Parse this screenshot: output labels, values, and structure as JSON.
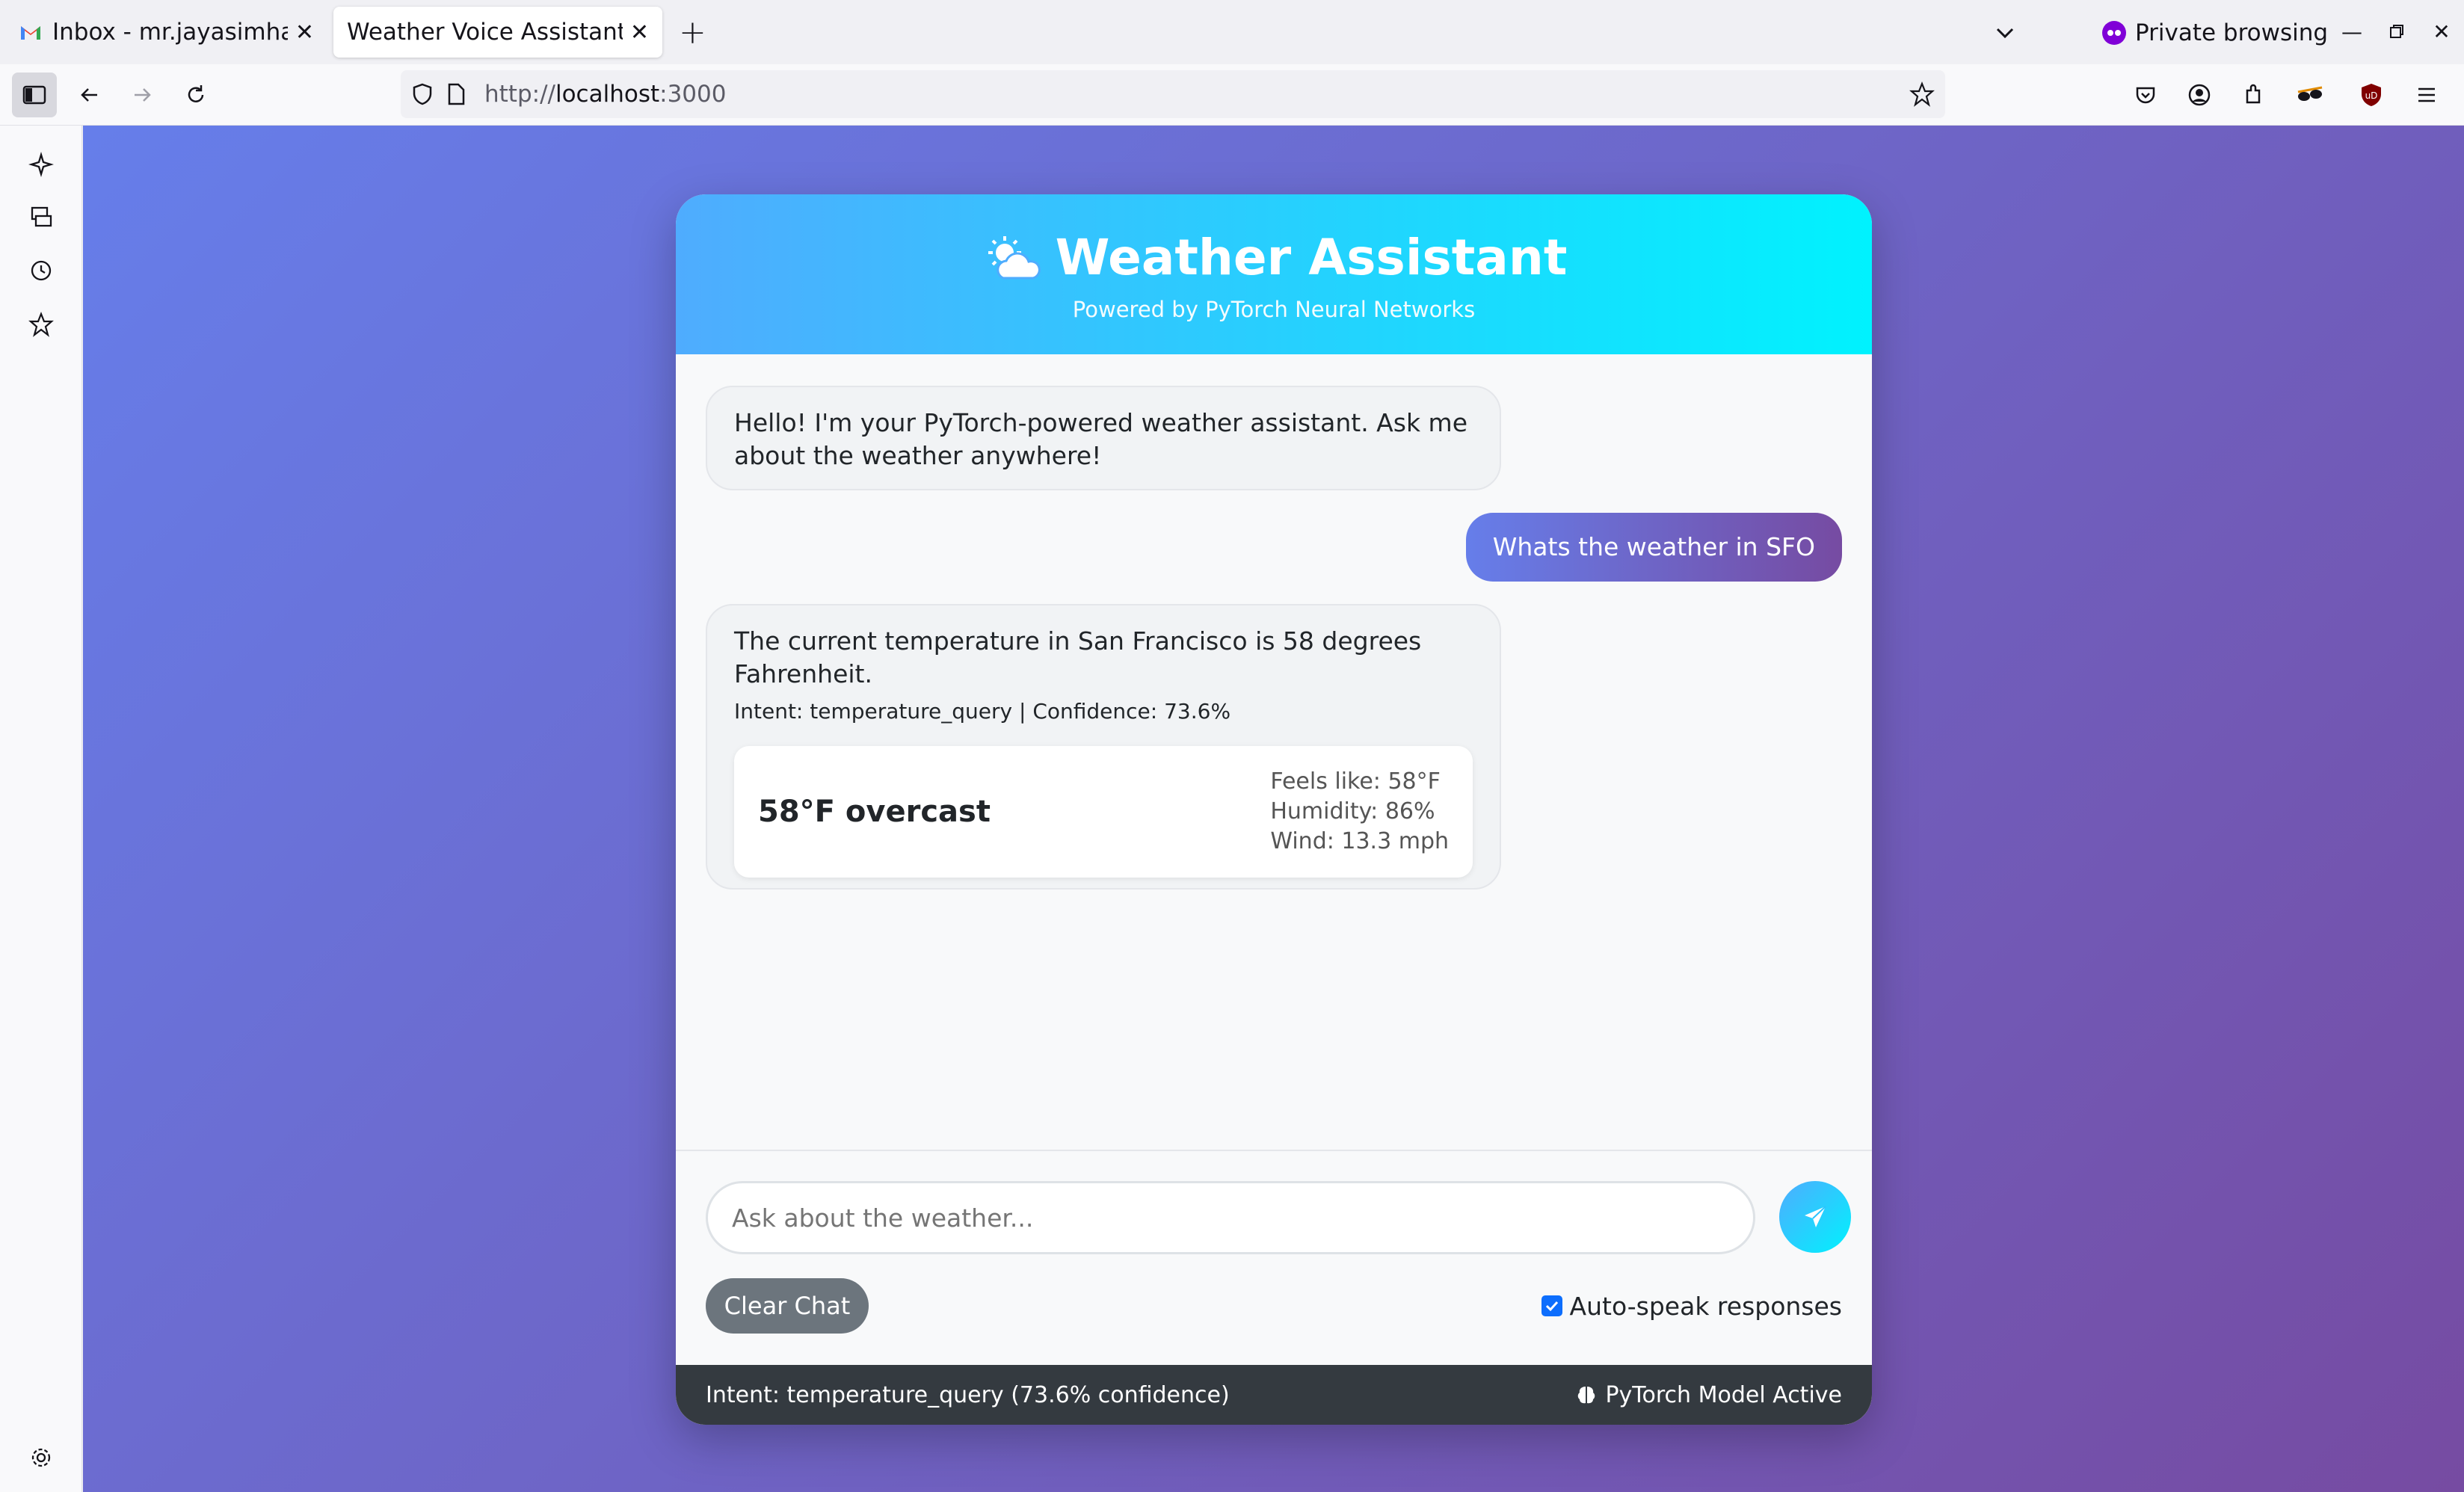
{
  "browser": {
    "tabs": [
      {
        "label": "Inbox - mr.jayasimha@g",
        "icon": "gmail-icon"
      },
      {
        "label": "Weather Voice Assistant",
        "icon": null
      }
    ],
    "private_label": "Private browsing",
    "url_scheme": "http://",
    "url_host": "localhost",
    "url_port": ":3000"
  },
  "app": {
    "title": "Weather Assistant",
    "subtitle": "Powered by PyTorch Neural Networks",
    "messages": [
      {
        "role": "bot",
        "text": "Hello! I'm your PyTorch-powered weather assistant. Ask me about the weather anywhere!"
      },
      {
        "role": "user",
        "text": "Whats the weather in SFO"
      },
      {
        "role": "bot",
        "text": "The current temperature in San Francisco is 58 degrees Fahrenheit.",
        "meta": "Intent: temperature_query | Confidence: 73.6%",
        "weather": {
          "main": "58°F overcast",
          "feels_like": "Feels like: 58°F",
          "humidity": "Humidity: 86%",
          "wind": "Wind: 13.3 mph"
        }
      }
    ],
    "input_placeholder": "Ask about the weather...",
    "clear_label": "Clear Chat",
    "autospeak_label": "Auto-speak responses",
    "autospeak_checked": true,
    "status_left": "Intent: temperature_query (73.6% confidence)",
    "status_right": "PyTorch Model Active"
  },
  "colors": {
    "header_gradient_start": "#4facfe",
    "header_gradient_end": "#00f2fe",
    "page_gradient_start": "#667eea",
    "page_gradient_end": "#764ba2",
    "status_bar": "#343a40"
  }
}
